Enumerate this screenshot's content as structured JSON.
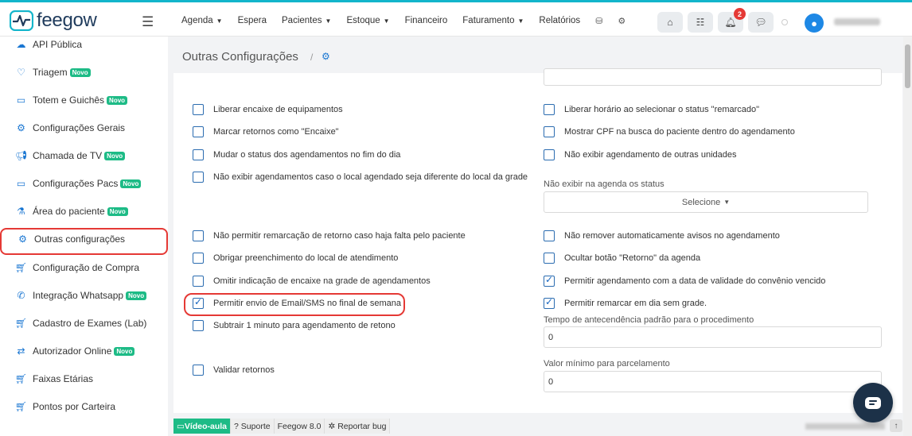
{
  "app": {
    "logo_text": "feegow",
    "brand_color": "#12b5cb",
    "accent": "#1976d2",
    "highlight_color": "#e53935"
  },
  "nav": {
    "items": [
      {
        "label": "Agenda",
        "dropdown": true
      },
      {
        "label": "Espera",
        "dropdown": false
      },
      {
        "label": "Pacientes",
        "dropdown": true
      },
      {
        "label": "Estoque",
        "dropdown": true
      },
      {
        "label": "Financeiro",
        "dropdown": false
      },
      {
        "label": "Faturamento",
        "dropdown": true
      },
      {
        "label": "Relatórios",
        "dropdown": false
      }
    ],
    "icons": [
      "database-icon",
      "settings-icon"
    ],
    "notifications_count": "2"
  },
  "sidebar": {
    "items": [
      {
        "label": "API Pública",
        "icon": "cloud-upload-icon",
        "novo": false
      },
      {
        "label": "Triagem",
        "icon": "stethoscope-icon",
        "novo": true
      },
      {
        "label": "Totem e Guichês",
        "icon": "laptop-icon",
        "novo": true
      },
      {
        "label": "Configurações Gerais",
        "icon": "gears-icon",
        "novo": false
      },
      {
        "label": "Chamada de TV",
        "icon": "megaphone-icon",
        "novo": true
      },
      {
        "label": "Configurações Pacs",
        "icon": "laptop-icon",
        "novo": true
      },
      {
        "label": "Área do paciente",
        "icon": "flask-icon",
        "novo": true
      },
      {
        "label": "Outras configurações",
        "icon": "gears-icon",
        "novo": false,
        "active": true
      },
      {
        "label": "Configuração de Compra",
        "icon": "cart-icon",
        "novo": false
      },
      {
        "label": "Integração Whatsapp",
        "icon": "whatsapp-icon",
        "novo": true
      },
      {
        "label": "Cadastro de Exames (Lab)",
        "icon": "cart-icon",
        "novo": false
      },
      {
        "label": "Autorizador Online",
        "icon": "exchange-icon",
        "novo": true
      },
      {
        "label": "Faixas Etárias",
        "icon": "cart-icon",
        "novo": false
      },
      {
        "label": "Pontos por Carteira",
        "icon": "cart-icon",
        "novo": false
      }
    ],
    "novo_label": "Novo"
  },
  "page": {
    "title": "Outras Configurações",
    "breadcrumb_sep": "/"
  },
  "left_options": [
    {
      "label": "Liberar encaixe de equipamentos",
      "checked": false
    },
    {
      "label": "Marcar retornos como \"Encaixe\"",
      "checked": false
    },
    {
      "label": "Mudar o status dos agendamentos no fim do dia",
      "checked": false
    },
    {
      "label": "Não exibir agendamentos caso o local agendado seja diferente do local da grade",
      "checked": false
    },
    {
      "label": "Não permitir remarcação de retorno caso haja falta pelo paciente",
      "checked": false
    },
    {
      "label": "Obrigar preenchimento do local de atendimento",
      "checked": false
    },
    {
      "label": "Omitir indicação de encaixe na grade de agendamentos",
      "checked": false
    },
    {
      "label": "Permitir envio de Email/SMS no final de semana",
      "checked": true,
      "highlighted": true
    },
    {
      "label": "Subtrair 1 minuto para agendamento de retono",
      "checked": false
    },
    {
      "label": "Validar retornos",
      "checked": false
    }
  ],
  "right_options": [
    {
      "label": "Liberar horário ao selecionar o status \"remarcado\"",
      "checked": false
    },
    {
      "label": "Mostrar CPF na busca do paciente dentro do agendamento",
      "checked": false
    },
    {
      "label": "Não exibir agendamento de outras unidades",
      "checked": false
    },
    {
      "label": "Não remover automaticamente avisos no agendamento",
      "checked": false
    },
    {
      "label": "Ocultar botão \"Retorno\" da agenda",
      "checked": false
    },
    {
      "label": "Permitir agendamento com a data de validade do convênio vencido",
      "checked": true
    },
    {
      "label": "Permitir remarcar em dia sem grade.",
      "checked": true
    }
  ],
  "fields": {
    "status_filter_label": "Não exibir na agenda os status",
    "status_filter_value": "Selecione",
    "antecedencia_label": "Tempo de antecendência padrão para o procedimento",
    "antecedencia_value": "0",
    "parcelamento_label": "Valor mínimo para parcelamento",
    "parcelamento_value": "0"
  },
  "footer": {
    "video": "Vídeo-aula",
    "support": "Suporte",
    "version": "Feegow 8.0",
    "bug": "Reportar bug"
  }
}
